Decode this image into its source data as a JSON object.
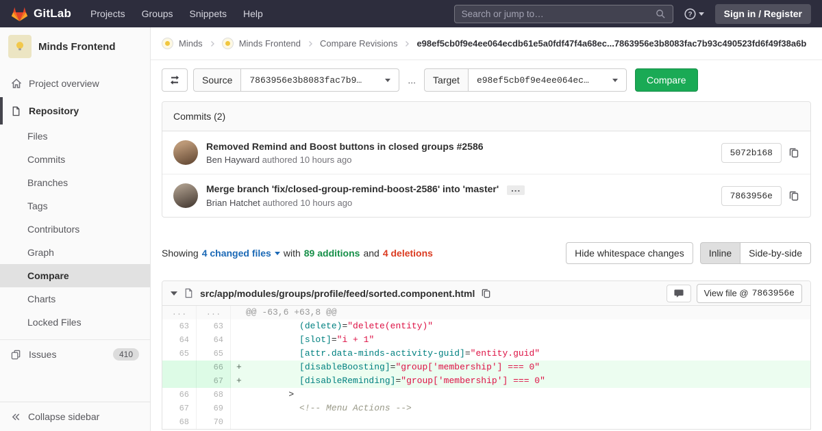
{
  "colors": {
    "navbar_bg": "#2d2d3d",
    "compare_button_green": "#1aaa55",
    "link_blue": "#1b69b6",
    "additions_green": "#168f48",
    "deletions_red": "#db3b21",
    "added_line_bg": "#ecfdf0",
    "added_gutter_bg": "#ddfbe6"
  },
  "navbar": {
    "brand": "GitLab",
    "menu": [
      "Projects",
      "Groups",
      "Snippets",
      "Help"
    ],
    "search_placeholder": "Search or jump to…",
    "signin_label": "Sign in / Register"
  },
  "sidebar": {
    "project_name": "Minds Frontend",
    "overview_label": "Project overview",
    "repository_label": "Repository",
    "repo_items": [
      "Files",
      "Commits",
      "Branches",
      "Tags",
      "Contributors",
      "Graph",
      "Compare",
      "Charts",
      "Locked Files"
    ],
    "active_item": "Compare",
    "issues_label": "Issues",
    "issues_count": "410",
    "collapse_label": "Collapse sidebar"
  },
  "breadcrumb": {
    "items": [
      "Minds",
      "Minds Frontend",
      "Compare Revisions"
    ],
    "current": "e98ef5cb0f9e4ee064ecdb61e5a0fdf47f4a68ec...7863956e3b8083fac7b93c490523fd6f49f38a6b"
  },
  "compare_form": {
    "source_label": "Source",
    "source_value": "7863956e3b8083fac7b9…",
    "separator": "...",
    "target_label": "Target",
    "target_value": "e98ef5cb0f9e4ee064ec…",
    "compare_button": "Compare"
  },
  "commits": {
    "header": "Commits (2)",
    "items": [
      {
        "title": "Removed Remind and Boost buttons in closed groups #2586",
        "author": "Ben Hayward",
        "authored": "authored 10 hours ago",
        "sha": "5072b168"
      },
      {
        "title": "Merge branch 'fix/closed-group-remind-boost-2586' into 'master'",
        "ellipsis_label": "...",
        "author": "Brian Hatchet",
        "authored": "authored 10 hours ago",
        "sha": "7863956e"
      }
    ]
  },
  "diff_summary": {
    "showing": "Showing",
    "changed_files": "4 changed files",
    "with": "with",
    "additions": "89 additions",
    "and": "and",
    "deletions": "4 deletions",
    "hide_whitespace": "Hide whitespace changes",
    "inline": "Inline",
    "side_by_side": "Side-by-side"
  },
  "diff_file": {
    "path": "src/app/modules/groups/profile/feed/sorted.component.html",
    "view_file_label": "View file @",
    "view_file_sha": "7863956e",
    "lines": [
      {
        "type": "hunk",
        "old": "...",
        "new": "...",
        "prefix": "",
        "segments": [
          {
            "t": "@@ -63,6 +63,8 @@",
            "c": "h"
          }
        ]
      },
      {
        "type": "context",
        "old": "63",
        "new": "63",
        "prefix": "",
        "segments": [
          {
            "t": "          ",
            "c": "p"
          },
          {
            "t": "(delete)",
            "c": "na"
          },
          {
            "t": "=",
            "c": "p"
          },
          {
            "t": "\"delete(entity)\"",
            "c": "s"
          }
        ]
      },
      {
        "type": "context",
        "old": "64",
        "new": "64",
        "prefix": "",
        "segments": [
          {
            "t": "          ",
            "c": "p"
          },
          {
            "t": "[slot]",
            "c": "na"
          },
          {
            "t": "=",
            "c": "p"
          },
          {
            "t": "\"i + 1\"",
            "c": "s"
          }
        ]
      },
      {
        "type": "context",
        "old": "65",
        "new": "65",
        "prefix": "",
        "segments": [
          {
            "t": "          ",
            "c": "p"
          },
          {
            "t": "[attr.data-minds-activity-guid]",
            "c": "na"
          },
          {
            "t": "=",
            "c": "p"
          },
          {
            "t": "\"entity.guid\"",
            "c": "s"
          }
        ]
      },
      {
        "type": "add",
        "old": "",
        "new": "66",
        "prefix": "+",
        "segments": [
          {
            "t": "          ",
            "c": "p"
          },
          {
            "t": "[disableBoosting]",
            "c": "na"
          },
          {
            "t": "=",
            "c": "p"
          },
          {
            "t": "\"group['membership'] === 0\"",
            "c": "s"
          }
        ]
      },
      {
        "type": "add",
        "old": "",
        "new": "67",
        "prefix": "+",
        "segments": [
          {
            "t": "          ",
            "c": "p"
          },
          {
            "t": "[disableReminding]",
            "c": "na"
          },
          {
            "t": "=",
            "c": "p"
          },
          {
            "t": "\"group['membership'] === 0\"",
            "c": "s"
          }
        ]
      },
      {
        "type": "context",
        "old": "66",
        "new": "68",
        "prefix": "",
        "segments": [
          {
            "t": "        >",
            "c": "p"
          }
        ]
      },
      {
        "type": "context",
        "old": "67",
        "new": "69",
        "prefix": "",
        "segments": [
          {
            "t": "          ",
            "c": "p"
          },
          {
            "t": "<!-- Menu Actions -->",
            "c": "c"
          }
        ]
      },
      {
        "type": "context",
        "old": "68",
        "new": "70",
        "prefix": "",
        "segments": []
      }
    ]
  }
}
